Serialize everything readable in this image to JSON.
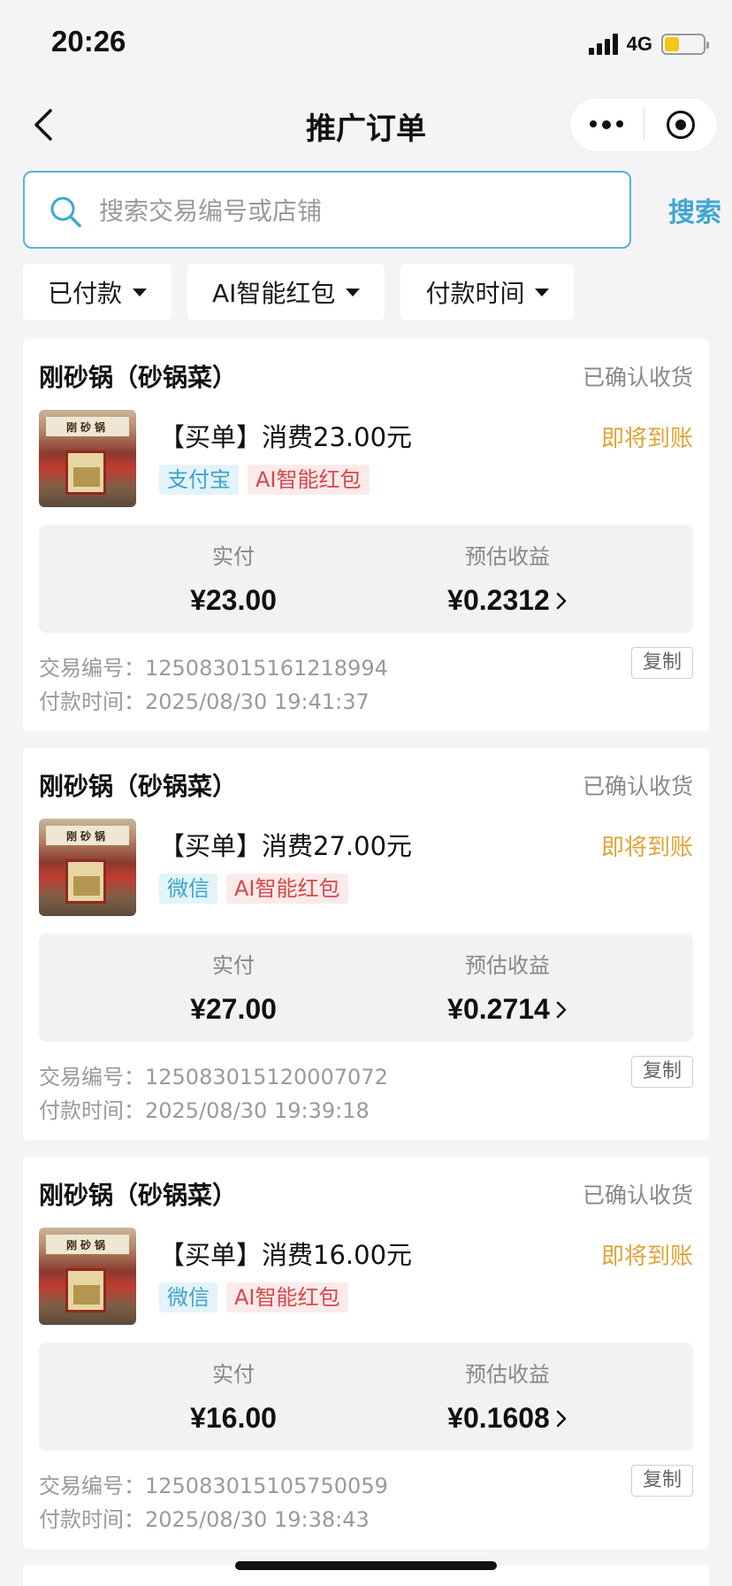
{
  "status_bar": {
    "time": "20:26",
    "network": "4G",
    "battery_level": 0.38,
    "battery_color": "#f5c518"
  },
  "nav": {
    "title": "推广订单",
    "back_icon": "chevron-left-icon",
    "more_icon": "more-dots-icon",
    "close_icon": "target-icon"
  },
  "search": {
    "placeholder": "搜索交易编号或店铺",
    "value": "",
    "button_label": "搜索",
    "accent": "#3ea8d3"
  },
  "filters": [
    {
      "label": "已付款"
    },
    {
      "label": "AI智能红包"
    },
    {
      "label": "付款时间"
    }
  ],
  "labels": {
    "paid": "实付",
    "estimated_income": "预估收益",
    "trade_no_prefix": "交易编号：",
    "pay_time_prefix": "付款时间：",
    "copy": "复制"
  },
  "orders": [
    {
      "shop": "刚砂锅（砂锅菜）",
      "status": "已确认收货",
      "title": "【买单】消费23.00元",
      "arrival": "即将到账",
      "pay_method": "支付宝",
      "tag": "AI智能红包",
      "paid": "¥23.00",
      "income": "¥0.2312",
      "trade_no": "125083015161218994",
      "pay_time": "2025/08/30 19:41:37"
    },
    {
      "shop": "刚砂锅（砂锅菜）",
      "status": "已确认收货",
      "title": "【买单】消费27.00元",
      "arrival": "即将到账",
      "pay_method": "微信",
      "tag": "AI智能红包",
      "paid": "¥27.00",
      "income": "¥0.2714",
      "trade_no": "125083015120007072",
      "pay_time": "2025/08/30 19:39:18"
    },
    {
      "shop": "刚砂锅（砂锅菜）",
      "status": "已确认收货",
      "title": "【买单】消费16.00元",
      "arrival": "即将到账",
      "pay_method": "微信",
      "tag": "AI智能红包",
      "paid": "¥16.00",
      "income": "¥0.1608",
      "trade_no": "125083015105750059",
      "pay_time": "2025/08/30 19:38:43"
    }
  ],
  "colors": {
    "arrival": "#e0a335",
    "pay_tag": "#3aa4cf",
    "ai_tag": "#d8474a"
  }
}
